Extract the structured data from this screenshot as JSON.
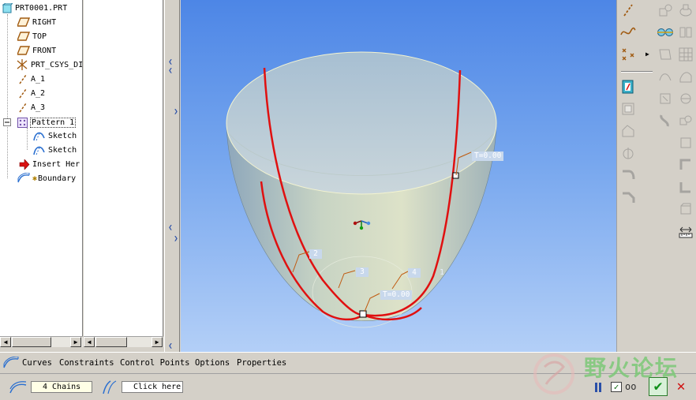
{
  "tree": {
    "items": [
      {
        "label": "PRT0001.PRT",
        "icon": "part-icon"
      },
      {
        "label": "RIGHT",
        "icon": "datum-plane-icon"
      },
      {
        "label": "TOP",
        "icon": "datum-plane-icon"
      },
      {
        "label": "FRONT",
        "icon": "datum-plane-icon"
      },
      {
        "label": "PRT_CSYS_DI",
        "icon": "coordinate-system-icon"
      },
      {
        "label": "A_1",
        "icon": "datum-axis-icon"
      },
      {
        "label": "A_2",
        "icon": "datum-axis-icon"
      },
      {
        "label": "A_3",
        "icon": "datum-axis-icon"
      },
      {
        "label": "Pattern 1",
        "icon": "pattern-icon"
      },
      {
        "label": "Sketch",
        "icon": "sketch-icon"
      },
      {
        "label": "Sketch",
        "icon": "sketch-icon"
      },
      {
        "label": "Insert Her",
        "icon": "insert-here-arrow-icon"
      },
      {
        "label": "Boundary",
        "icon": "boundary-blend-icon"
      }
    ]
  },
  "viewport": {
    "labels": {
      "t_top": "T=0.00",
      "chain_2": "2",
      "chain_3": "3",
      "chain_4": "4",
      "chain_1": "1",
      "t_bottom": "T=0.00"
    },
    "colors": {
      "curve": "#e01010",
      "surface_top": "#a9c5d9",
      "surface_bottom": "#d6dcc4"
    }
  },
  "dashboard": {
    "tabs": [
      "Curves",
      "Constraints",
      "Control Points",
      "Options",
      "Properties"
    ],
    "chains_value": "4 Chains",
    "second_collector": "Click here"
  },
  "watermark": {
    "text": "野火论坛"
  }
}
